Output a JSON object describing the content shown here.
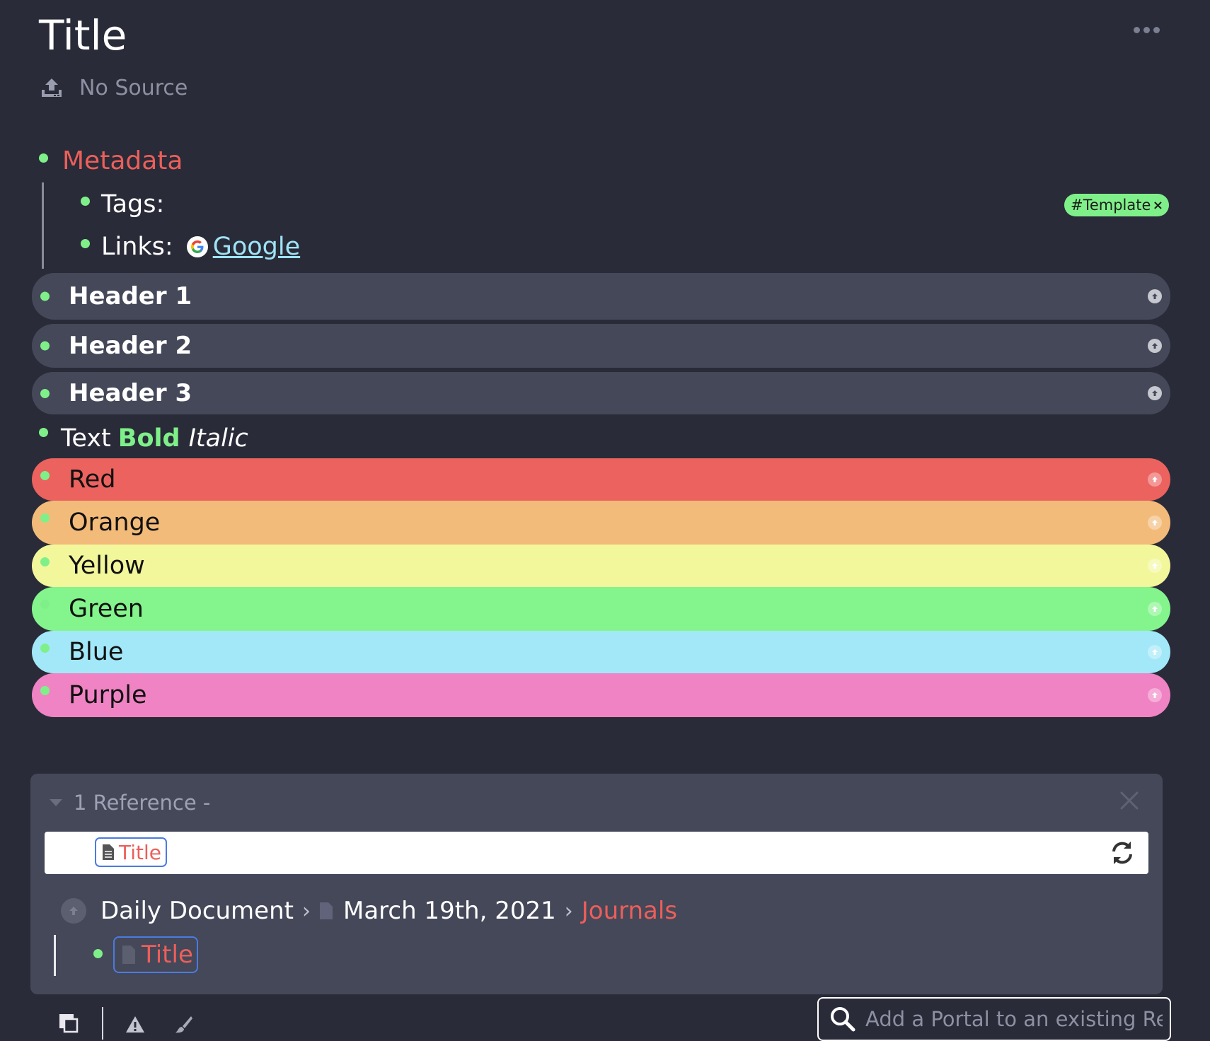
{
  "document": {
    "title": "Title",
    "source": "No Source"
  },
  "metadata": {
    "label": "Metadata",
    "tags_label": "Tags:",
    "links_label": "Links:",
    "link_text": "Google",
    "tag_chip": "#Template",
    "tag_remove": "×"
  },
  "headers": [
    {
      "label": "Header 1"
    },
    {
      "label": "Header 2"
    },
    {
      "label": "Header 3"
    }
  ],
  "text_line": {
    "plain": "Text",
    "bold": "Bold",
    "italic": "Italic"
  },
  "color_rows": [
    {
      "label": "Red",
      "color": "#eb625e"
    },
    {
      "label": "Orange",
      "color": "#f3bb7a"
    },
    {
      "label": "Yellow",
      "color": "#f3f79b"
    },
    {
      "label": "Green",
      "color": "#83f58c"
    },
    {
      "label": "Blue",
      "color": "#a2e8f8"
    },
    {
      "label": "Purple",
      "color": "#f083c4"
    }
  ],
  "references": {
    "heading": "1 Reference -",
    "portal_chip": "Title",
    "breadcrumb": {
      "item1": "Daily Document",
      "item2": "March 19th, 2021",
      "item3": "Journals"
    },
    "item_chip": "Title"
  },
  "portal_search": {
    "placeholder": "Add a Portal to an existing Rem"
  },
  "colors": {
    "background": "#292b38",
    "panel": "#454859",
    "accent_green": "#7ff089",
    "accent_red": "#ec5f5a",
    "link_blue": "#9fe3f6"
  }
}
